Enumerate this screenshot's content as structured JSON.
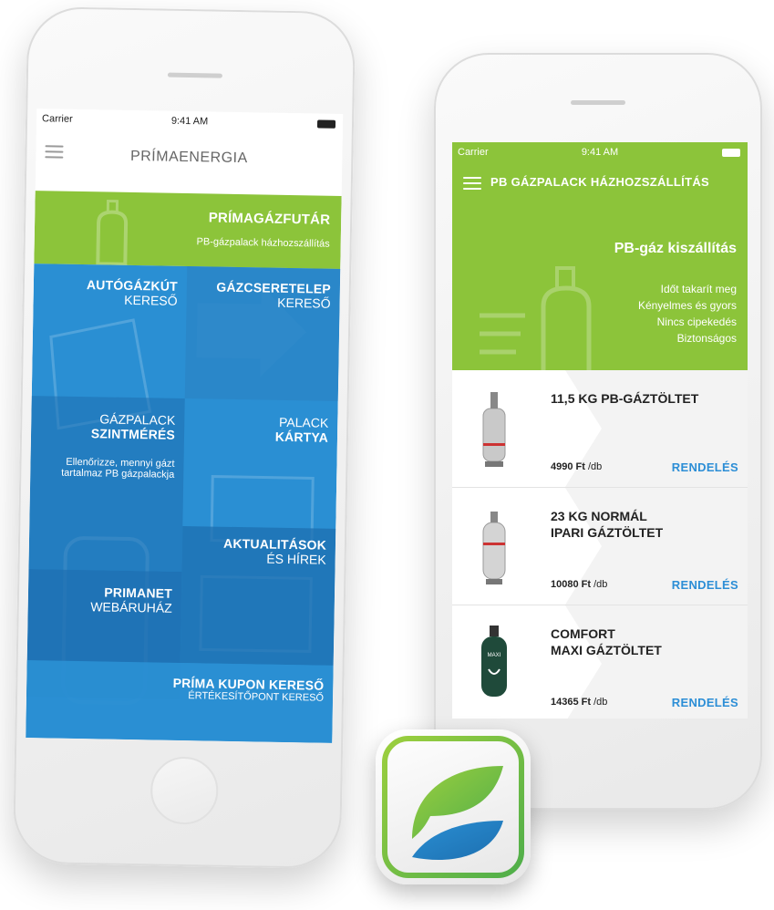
{
  "colors": {
    "green": "#8cc43a",
    "blue": "#2a8fd3",
    "dark_blue": "#1d6fb0",
    "mid_blue": "#2a86c8",
    "link": "#2c8ed6"
  },
  "left_phone": {
    "status": {
      "carrier": "Carrier",
      "time": "9:41 AM"
    },
    "title": "PRÍMAENERGIA",
    "menu_icon": "hamburger-icon",
    "tiles": {
      "gazfutar": {
        "title": "PRÍMAGÁZFUTÁR",
        "subtitle": "PB-gázpalack házhozszállítás"
      },
      "autogazkut": {
        "line1": "AUTÓGÁZKÚT",
        "line2": "KERESŐ"
      },
      "gazcseretelep": {
        "line1": "GÁZCSERETELEP",
        "line2": "KERESŐ"
      },
      "szintmeres": {
        "line1": "GÁZPALACK",
        "line2": "SZINTMÉRÉS",
        "desc1": "Ellenőrizze, mennyi gázt",
        "desc2": "tartalmaz PB gázpalackja"
      },
      "palack_kartya": {
        "line1": "PALACK",
        "line2": "KÁRTYA"
      },
      "aktualitasok": {
        "line1": "AKTUALITÁSOK",
        "line2": "ÉS HÍREK"
      },
      "primanet": {
        "line1": "PRIMANET",
        "line2": "WEBÁRUHÁZ"
      },
      "kupon": {
        "line1": "PRÍMA KUPON KERESŐ",
        "line2": "ÉRTÉKESÍTŐPONT KERESŐ"
      }
    }
  },
  "right_phone": {
    "status": {
      "carrier": "Carrier",
      "time": "9:41 AM"
    },
    "header_title": "PB GÁZPALACK HÁZHOZSZÁLLÍTÁS",
    "menu_icon": "hamburger-icon",
    "hero": {
      "title": "PB-gáz kiszállítás",
      "features": [
        "Időt takarít meg",
        "Kényelmes és gyors",
        "Nincs cipekedés",
        "Biztonságos"
      ]
    },
    "products": [
      {
        "name_line1": "11,5 KG PB-GÁZTÖLTET",
        "name_line2": "",
        "price": "4990 Ft",
        "unit": "/db",
        "order": "RENDELÉS",
        "icon": "gas-cylinder-icon"
      },
      {
        "name_line1": "23 KG NORMÁL",
        "name_line2": "IPARI GÁZTÖLTET",
        "price": "10080 Ft",
        "unit": "/db",
        "order": "RENDELÉS",
        "icon": "industrial-cylinder-icon"
      },
      {
        "name_line1": "COMFORT",
        "name_line2": "MAXI GÁZTÖLTET",
        "price": "14365 Ft",
        "unit": "/db",
        "order": "RENDELÉS",
        "icon": "comfort-cylinder-icon"
      }
    ]
  },
  "app_icon": "primaenergia-leaf-icon"
}
